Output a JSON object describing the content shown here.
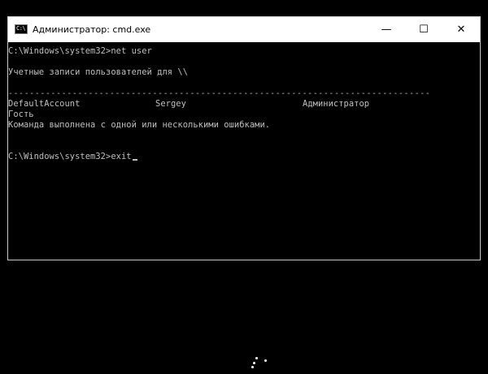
{
  "window": {
    "title": "Администратор: cmd.exe",
    "icon_label": "C:\\",
    "controls": {
      "minimize": "—",
      "maximize": "☐",
      "close": "✕"
    }
  },
  "console": {
    "lines": [
      "C:\\Windows\\system32>net user",
      "",
      "Учетные записи пользователей для \\\\",
      "",
      "-------------------------------------------------------------------------------",
      "",
      "Гость",
      "Команда выполнена с одной или несколькими ошибками.",
      "",
      "",
      "C:\\Windows\\system32>exit"
    ],
    "accounts": [
      "DefaultAccount",
      "Sergey",
      "Администратор"
    ],
    "text_color": "#c0c0c0",
    "background": "#000000"
  },
  "loading": {
    "icon": "spinner-icon"
  }
}
